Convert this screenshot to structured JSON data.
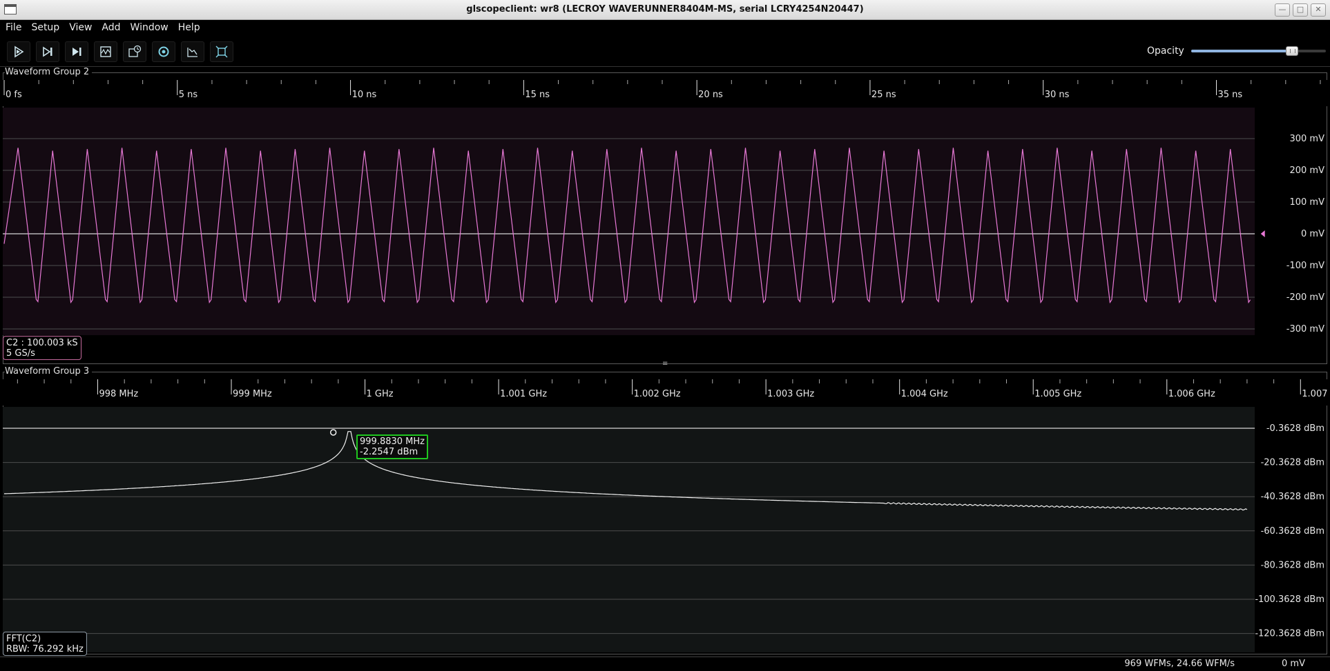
{
  "window": {
    "title": "glscopeclient: wr8 (LECROY WAVERUNNER8404M-MS, serial LCRY4254N20447)",
    "buttons": [
      "minimize",
      "maximize",
      "close"
    ]
  },
  "menu": [
    "File",
    "Setup",
    "View",
    "Add",
    "Window",
    "Help"
  ],
  "toolbar": {
    "buttons": [
      {
        "name": "start-trigger-button",
        "icon": "play-icon"
      },
      {
        "name": "single-trigger-button",
        "icon": "single-step-icon"
      },
      {
        "name": "force-trigger-button",
        "icon": "force-step-icon"
      },
      {
        "name": "stop-trigger-button",
        "icon": "waveform-stop-icon"
      },
      {
        "name": "history-button",
        "icon": "history-clock-icon"
      },
      {
        "name": "refresh-settings-button",
        "icon": "refresh-icon"
      },
      {
        "name": "clear-sweeps-button",
        "icon": "clear-sweeps-icon"
      },
      {
        "name": "fullscreen-button",
        "icon": "fullscreen-icon"
      }
    ],
    "opacity_label": "Opacity",
    "opacity_value": 0.75
  },
  "group2": {
    "label": "Waveform Group 2",
    "timescale": {
      "ticks": [
        {
          "value": 0,
          "label": "0 fs"
        },
        {
          "value": 5,
          "label": "5 ns"
        },
        {
          "value": 10,
          "label": "10 ns"
        },
        {
          "value": 15,
          "label": "15 ns"
        },
        {
          "value": 20,
          "label": "20 ns"
        },
        {
          "value": 25,
          "label": "25 ns"
        },
        {
          "value": 30,
          "label": "30 ns"
        },
        {
          "value": 35,
          "label": "35 ns"
        }
      ],
      "visible_end_ns": 38.2
    },
    "vaxis": {
      "ticks": [
        {
          "value": 300,
          "label": "300 mV"
        },
        {
          "value": 200,
          "label": "200 mV"
        },
        {
          "value": 100,
          "label": "100 mV"
        },
        {
          "value": 0,
          "label": "0 mV"
        },
        {
          "value": -100,
          "label": "-100 mV"
        },
        {
          "value": -200,
          "label": "-200 mV"
        },
        {
          "value": -300,
          "label": "-300 mV"
        }
      ]
    },
    "channel": {
      "line1": "C2 : 100.003 kS",
      "line2": "5 GS/s",
      "color": "#e879d6"
    },
    "waveform": {
      "period_ns": 1.0001,
      "phase_ns": 0.45,
      "high_mV": 265,
      "low_mV": -210,
      "end_ns": 36.2
    }
  },
  "group3": {
    "label": "Waveform Group 3",
    "freqscale": {
      "ticks": [
        {
          "value": 998,
          "label": "998 MHz"
        },
        {
          "value": 999,
          "label": "999 MHz"
        },
        {
          "value": 1000,
          "label": "1 GHz"
        },
        {
          "value": 1001,
          "label": "1.001 GHz"
        },
        {
          "value": 1002,
          "label": "1.002 GHz"
        },
        {
          "value": 1003,
          "label": "1.003 GHz"
        },
        {
          "value": 1004,
          "label": "1.004 GHz"
        },
        {
          "value": 1005,
          "label": "1.005 GHz"
        },
        {
          "value": 1006,
          "label": "1.006 GHz"
        },
        {
          "value": 1007,
          "label": "1.007"
        }
      ],
      "visible_start_MHz": 997.3,
      "visible_end_MHz": 1007.2
    },
    "vaxis": {
      "ticks": [
        {
          "value": -0.3628,
          "label": "-0.3628 dBm"
        },
        {
          "value": -20.3628,
          "label": "-20.3628 dBm"
        },
        {
          "value": -40.3628,
          "label": "-40.3628 dBm"
        },
        {
          "value": -60.3628,
          "label": "-60.3628 dBm"
        },
        {
          "value": -80.3628,
          "label": "-80.3628 dBm"
        },
        {
          "value": -100.3628,
          "label": "-100.3628 dBm"
        },
        {
          "value": -120.3628,
          "label": "-120.3628 dBm"
        }
      ]
    },
    "channel": {
      "line1": "FFT(C2)",
      "line2": "RBW: 76.292 kHz",
      "color": "#e8e8e8"
    },
    "spectrum": {
      "peak_MHz": 999.883,
      "peak_dBm": -2.2547,
      "start_MHz": 997.3,
      "end_MHz": 1006.6
    },
    "cursor": {
      "frequency": "999.8830 MHz",
      "level": "-2.2547 dBm"
    }
  },
  "status": {
    "rate": "969 WFMs, 24.66 WFM/s",
    "voltage": "0 mV"
  }
}
